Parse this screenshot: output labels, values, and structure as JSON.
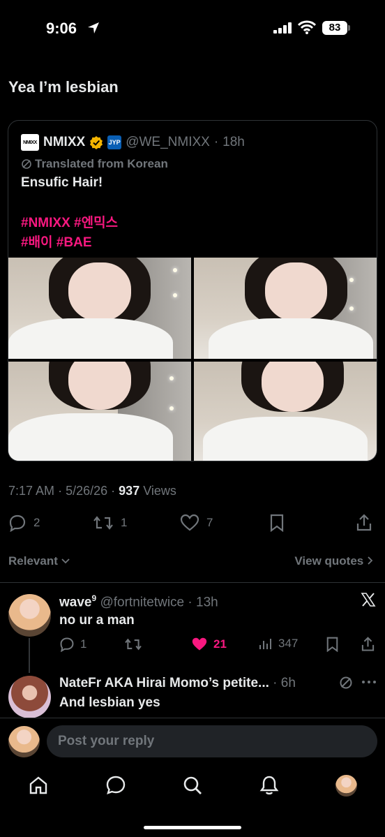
{
  "status_bar": {
    "time": "9:06",
    "battery": "83"
  },
  "post": {
    "text": "Yea I’m lesbian"
  },
  "quote": {
    "name": "NMIXX",
    "avatar_text": "NMIXX",
    "affiliate_text": "JYP",
    "handle": "@WE_NMIXX",
    "dot": "·",
    "time": "18h",
    "translated": "Translated from Korean",
    "line1": "Ensufic Hair!",
    "tags_line1": "#NMIXX #엔믹스",
    "tags_line2": "#배이 #BAE"
  },
  "meta": {
    "time": "7:17 AM",
    "date": "5/26/26",
    "views": "937",
    "views_label": "Views",
    "dot": "·"
  },
  "actions": {
    "replies": "2",
    "reposts": "1",
    "likes": "7"
  },
  "sort": {
    "label": "Relevant"
  },
  "view_quotes": {
    "label": "View quotes"
  },
  "replies": [
    {
      "name": "wave",
      "superscript": "9",
      "handle": "@fortnitetwice",
      "dot": "·",
      "time": "13h",
      "text": "no ur a man",
      "replies": "1",
      "likes": "21",
      "views": "347"
    },
    {
      "name": "NateFr AKA Hirai Momo’s petite...",
      "dot": "·",
      "time": "6h",
      "text": "And lesbian yes"
    }
  ],
  "composer": {
    "placeholder": "Post your reply"
  },
  "colors": {
    "accent_pink": "#f91880",
    "muted": "#71767b",
    "text": "#e7e9ea",
    "gold": "#f4b400"
  }
}
